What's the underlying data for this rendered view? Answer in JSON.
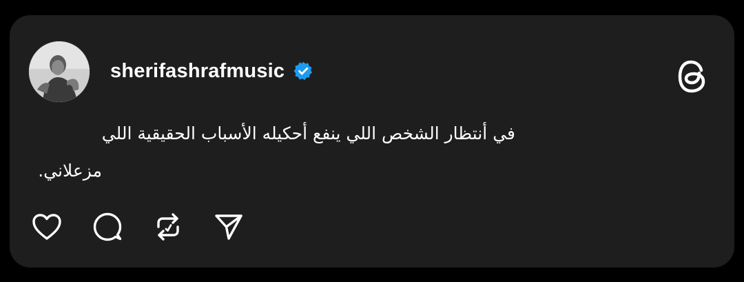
{
  "post": {
    "username": "sherifashrafmusic",
    "verified": true,
    "text_line1": "في أنتظار الشخص اللي ينفع أحكيله الأسباب الحقيقية اللي",
    "text_line2": "مزعلاني."
  },
  "actions": [
    {
      "name": "like",
      "icon": "heart-icon"
    },
    {
      "name": "reply",
      "icon": "comment-bubble-icon"
    },
    {
      "name": "repost",
      "icon": "repost-icon"
    },
    {
      "name": "share",
      "icon": "send-icon"
    }
  ],
  "colors": {
    "background": "#000000",
    "card": "#1e1e1e",
    "text": "#ffffff",
    "verified": "#1d9bf0"
  }
}
